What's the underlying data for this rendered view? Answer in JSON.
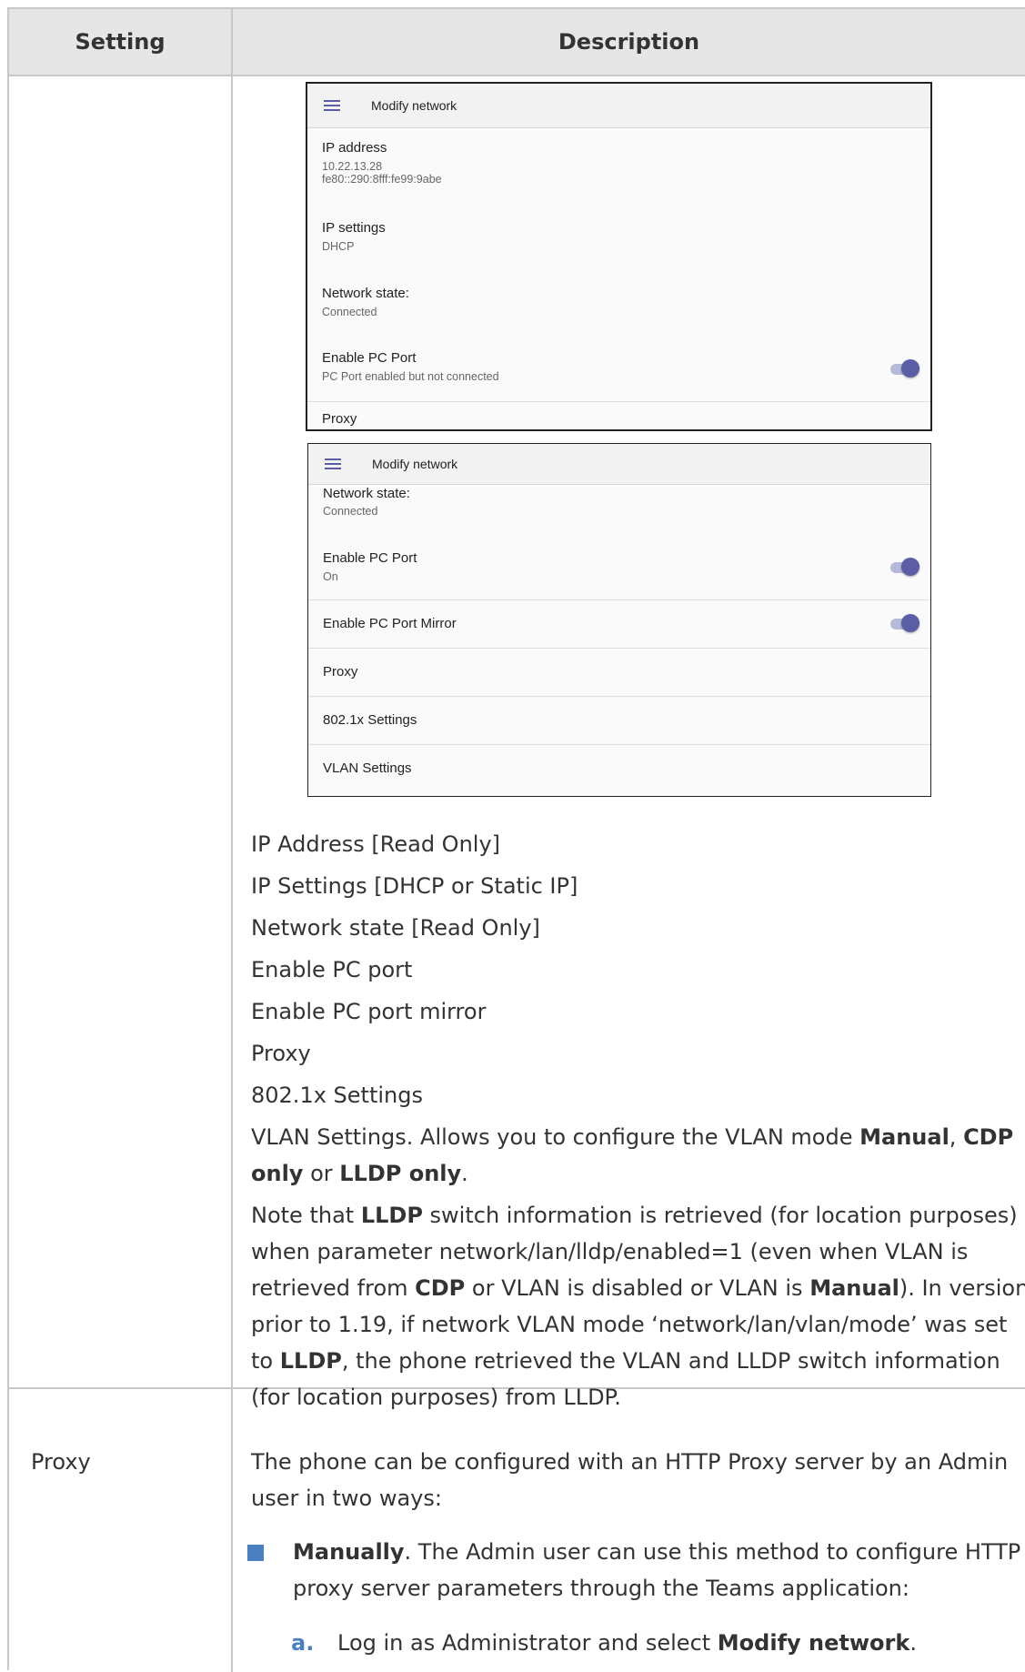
{
  "table": {
    "header_setting": "Setting",
    "header_description": "Description"
  },
  "screen1": {
    "title": "Modify network",
    "items": [
      {
        "title": "IP address",
        "sub1": "10.22.13.28",
        "sub2": "fe80::290:8fff:fe99:9abe"
      },
      {
        "title": "IP settings",
        "sub1": "DHCP"
      },
      {
        "title": "Network state:",
        "sub1": "Connected"
      },
      {
        "title": "Enable PC Port",
        "sub1": "PC Port enabled but not connected",
        "toggle_on": true
      },
      {
        "title": "Proxy"
      }
    ]
  },
  "screen2": {
    "title": "Modify network",
    "items": [
      {
        "title": "Network state:",
        "sub1": "Connected"
      },
      {
        "title": "Enable PC Port",
        "sub1": "On",
        "toggle_on": true
      },
      {
        "title": "Enable PC Port Mirror",
        "toggle_on": true
      },
      {
        "title": "Proxy"
      },
      {
        "title": "802.1x Settings"
      },
      {
        "title": "VLAN Settings"
      }
    ]
  },
  "options": [
    "IP Address [Read Only]",
    "IP Settings [DHCP or Static IP]",
    "Network state [Read Only]",
    "Enable PC port",
    "Enable PC port mirror",
    "Proxy",
    "802.1x Settings"
  ],
  "vlan": {
    "text1": "VLAN Settings. Allows you to configure the VLAN mode ",
    "manual": "Manual",
    "comma": ", ",
    "cdp": "CDP",
    "only1": "only",
    "or": " or ",
    "lldp_only": "LLDP only",
    "period": "."
  },
  "note": {
    "p1": "Note that ",
    "lldp": "LLDP",
    "p2": " switch information is retrieved (for location purposes)",
    "line2": "when parameter network/lan/lldp/enabled=1 (even when VLAN is",
    "p3": "retrieved from ",
    "cdp": "CDP",
    "p4": " or VLAN is disabled or VLAN is ",
    "manual": "Manual",
    "p5": "). In versions",
    "line4": "prior to 1.19, if network VLAN mode ‘network/lan/vlan/mode’ was set",
    "p6": "to ",
    "lldp2": "LLDP",
    "p7": ", the phone retrieved the VLAN and LLDP switch information",
    "line6": "(for location purposes) from LLDP."
  },
  "proxy_row": {
    "setting": "Proxy",
    "intro1": "The phone can be configured with an HTTP Proxy server by an Admin",
    "intro2": "user in two ways:",
    "bullet_bold": "Manually",
    "bullet_rest1": ". The Admin user can use this method to configure HTTP",
    "bullet_line2": "proxy server parameters through the Teams application:",
    "step_letter": "a.",
    "step_text": "Log in as Administrator and select ",
    "step_bold": "Modify network",
    "step_end": "."
  }
}
